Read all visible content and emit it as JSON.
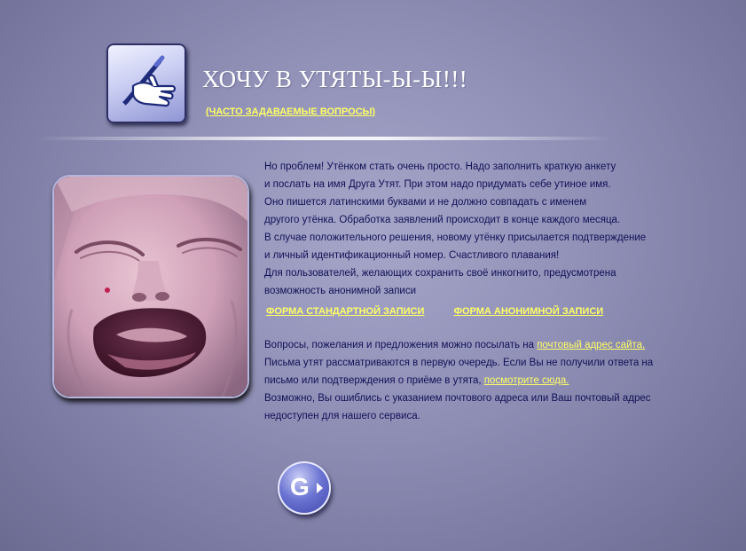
{
  "header": {
    "logo_icon": "hand-writing-with-pen-icon",
    "title": "ХОЧУ В УТЯТЫ-Ы-Ы!!!",
    "faq_link": "(ЧАСТО ЗАДАВАЕМЫЕ ВОПРОСЫ)"
  },
  "photo": {
    "subject": "crying-baby-photo"
  },
  "intro": {
    "lines": [
      "Но проблем! Утёнком стать очень просто. Надо заполнить краткую анкету",
      "и послать на имя Друга Утят. При этом надо придумать себе утиное имя.",
      "Оно пишется латинскими буквами и не должно совпадать с именем",
      "другого утёнка. Обработка заявлений происходит в конце каждого месяца.",
      "В случае положительного решения, новому утёнку присылается подтверждение",
      "и личный идентификационный номер. Счастливого плавания!",
      "Для пользователей, желающих сохранить своё инкогнито, предусмотрена",
      "возможность анонимной записи"
    ]
  },
  "forms": {
    "standard_link": "ФОРМА СТАНДАРТНОЙ ЗАПИСИ",
    "anonymous_link": "ФОРМА АНОНИМНОЙ ЗАПИСИ"
  },
  "contact": {
    "line1_text": "Вопросы, пожелания и предложения можно посылать на ",
    "line1_link": "почтовый адрес сайта.",
    "line2": "Письма утят рассматриваются в первую очередь. Если Вы не получили ответа на",
    "line3_text": "письмо или подтверждения о приёме в утята, ",
    "line3_link": "посмотрите сюда.",
    "line4": "Возможно, Вы ошиблись с указанием почтового адреса или Ваш почтовый адрес",
    "line5": "недоступен для нашего сервиса."
  },
  "go_button": {
    "label": "G",
    "icon": "go-arrow-icon"
  }
}
